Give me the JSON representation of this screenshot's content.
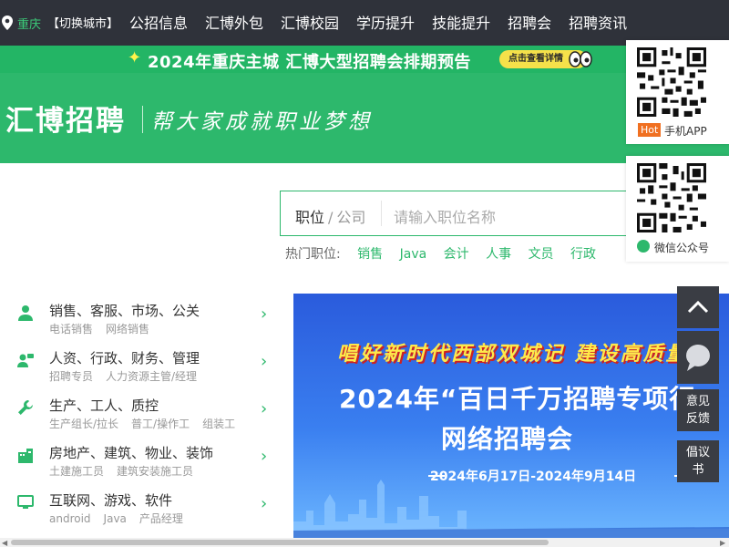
{
  "topnav": {
    "city": "重庆",
    "switch_city": "【切换城市】",
    "links": [
      "公招信息",
      "汇博外包",
      "汇博校园",
      "学历提升",
      "技能提升",
      "招聘会",
      "招聘资讯"
    ]
  },
  "banner_strip": {
    "text": "2024年重庆主城 汇博大型招聘会排期预告",
    "cta": "点击查看详情"
  },
  "header": {
    "logo": "汇博招聘",
    "slogan": "帮大家成就职业梦想"
  },
  "search": {
    "tab_active": "职位",
    "tab_sep": "/",
    "tab_inactive": "公司",
    "placeholder": "请输入职位名称"
  },
  "hot_jobs": {
    "label": "热门职位:",
    "items": [
      "销售",
      "Java",
      "会计",
      "人事",
      "文员",
      "行政"
    ]
  },
  "categories": [
    {
      "title": "销售、客服、市场、公关",
      "subs": [
        "电话销售",
        "网络销售"
      ],
      "icon": "person-icon"
    },
    {
      "title": "人资、行政、财务、管理",
      "subs": [
        "招聘专员",
        "人力资源主管/经理"
      ],
      "icon": "people-icon"
    },
    {
      "title": "生产、工人、质控",
      "subs": [
        "生产组长/拉长",
        "普工/操作工",
        "组装工"
      ],
      "icon": "wrench-icon"
    },
    {
      "title": "房地产、建筑、物业、装饰",
      "subs": [
        "土建施工员",
        "建筑安装施工员"
      ],
      "icon": "building-icon"
    },
    {
      "title": "互联网、游戏、软件",
      "subs": [
        "android",
        "Java",
        "产品经理"
      ],
      "icon": "monitor-icon"
    }
  ],
  "promo": {
    "line1": "唱好新时代西部双城记 建设高质量",
    "line2": "2024年“百日千万招聘专项行",
    "line3": "网络招聘会",
    "line4": "2024年6月17日-2024年9月14日"
  },
  "qr_app": {
    "badge": "Hot",
    "label": "手机APP"
  },
  "qr_wechat": {
    "label": "微信公众号"
  },
  "side_buttons": {
    "feedback_1": "意见",
    "feedback_2": "反馈",
    "letter_1": "倡议",
    "letter_2": "书"
  },
  "colors": {
    "brand_green": "#2db86c",
    "nav_dark": "#2f323a",
    "promo_blue": "#2a5bdc",
    "hot_orange": "#f07021"
  }
}
